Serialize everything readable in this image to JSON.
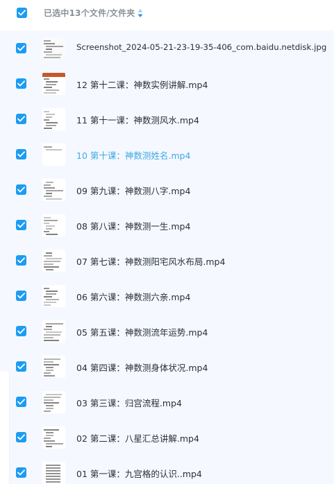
{
  "header": {
    "title": "已选中13个文件/文件夹",
    "sort_icon": "sort-toggle-icon"
  },
  "colors": {
    "checkbox": "#1c9cf2",
    "list_background": "#f5f9ff",
    "active_text": "#3da7e6",
    "header_text": "#8a8f99"
  },
  "files": [
    {
      "name": "Screenshot_2024-05-21-23-19-35-406_com.baidu.netdisk.jpg",
      "selected": true,
      "active": false
    },
    {
      "name": "12 第十二课：神数实例讲解.mp4",
      "selected": true,
      "active": false
    },
    {
      "name": "11 第十一课：神数测风水.mp4",
      "selected": true,
      "active": false
    },
    {
      "name": "10 第十课：神数测姓名.mp4",
      "selected": true,
      "active": true
    },
    {
      "name": "09 第九课：神数测八字.mp4",
      "selected": true,
      "active": false
    },
    {
      "name": "08 第八课：神数测一生.mp4",
      "selected": true,
      "active": false
    },
    {
      "name": "07 第七课：神数测阳宅风水布局.mp4",
      "selected": true,
      "active": false
    },
    {
      "name": "06 第六课：神数测六亲.mp4",
      "selected": true,
      "active": false
    },
    {
      "name": "05 第五课：神数测流年运势.mp4",
      "selected": true,
      "active": false
    },
    {
      "name": "04 第四课：神数测身体状况.mp4",
      "selected": true,
      "active": false
    },
    {
      "name": "03 第三课：归宫流程.mp4",
      "selected": true,
      "active": false
    },
    {
      "name": "02 第二课：八星汇总讲解.mp4",
      "selected": true,
      "active": false
    },
    {
      "name": "01 第一课：九宫格的认识..mp4",
      "selected": true,
      "active": false
    }
  ]
}
